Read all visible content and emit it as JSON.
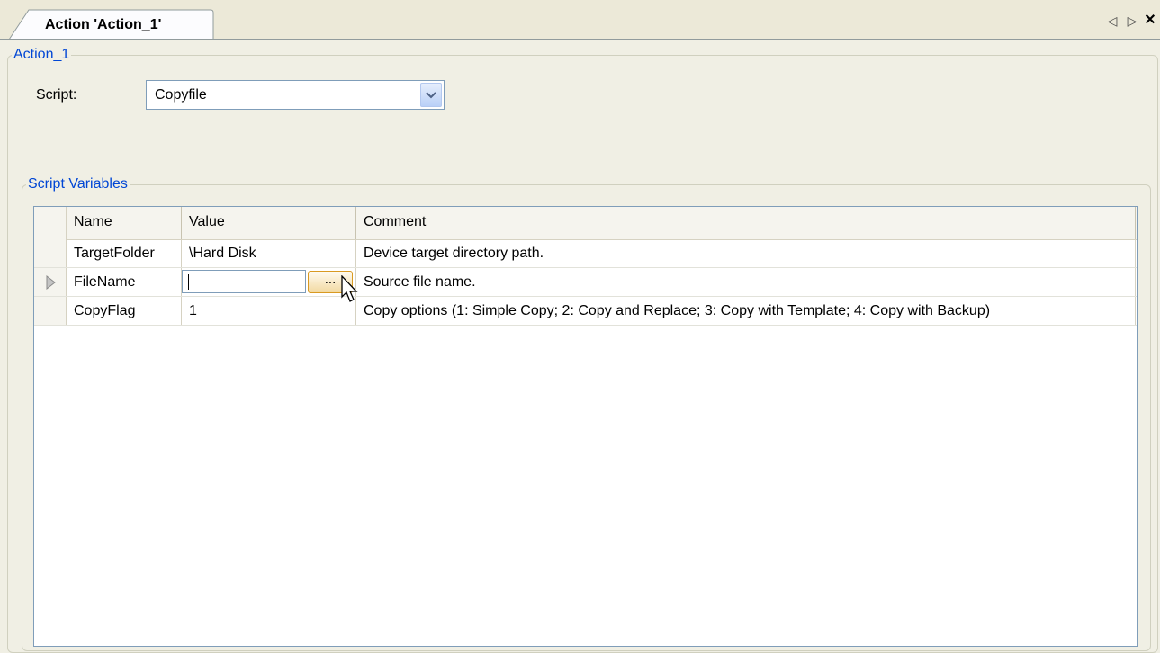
{
  "tab": {
    "title": "Action 'Action_1'"
  },
  "tab_controls": {
    "prev_icon": "◁",
    "next_icon": "▷",
    "close_icon": "✕"
  },
  "action_group": {
    "legend": "Action_1",
    "script_label": "Script:",
    "script_value": "Copyfile"
  },
  "variables_group": {
    "legend": "Script Variables"
  },
  "grid": {
    "columns": [
      "Name",
      "Value",
      "Comment"
    ],
    "rows": [
      {
        "name": "TargetFolder",
        "value": "\\Hard Disk",
        "comment": "Device target directory path."
      },
      {
        "name": "FileName",
        "value": "",
        "comment": "Source file name."
      },
      {
        "name": "CopyFlag",
        "value": "1",
        "comment": "Copy options (1: Simple Copy; 2: Copy and Replace; 3: Copy with Template; 4: Copy with Backup)"
      }
    ],
    "browse_label": "..."
  },
  "colors": {
    "legend": "#0046d5",
    "background": "#ece9d8"
  }
}
